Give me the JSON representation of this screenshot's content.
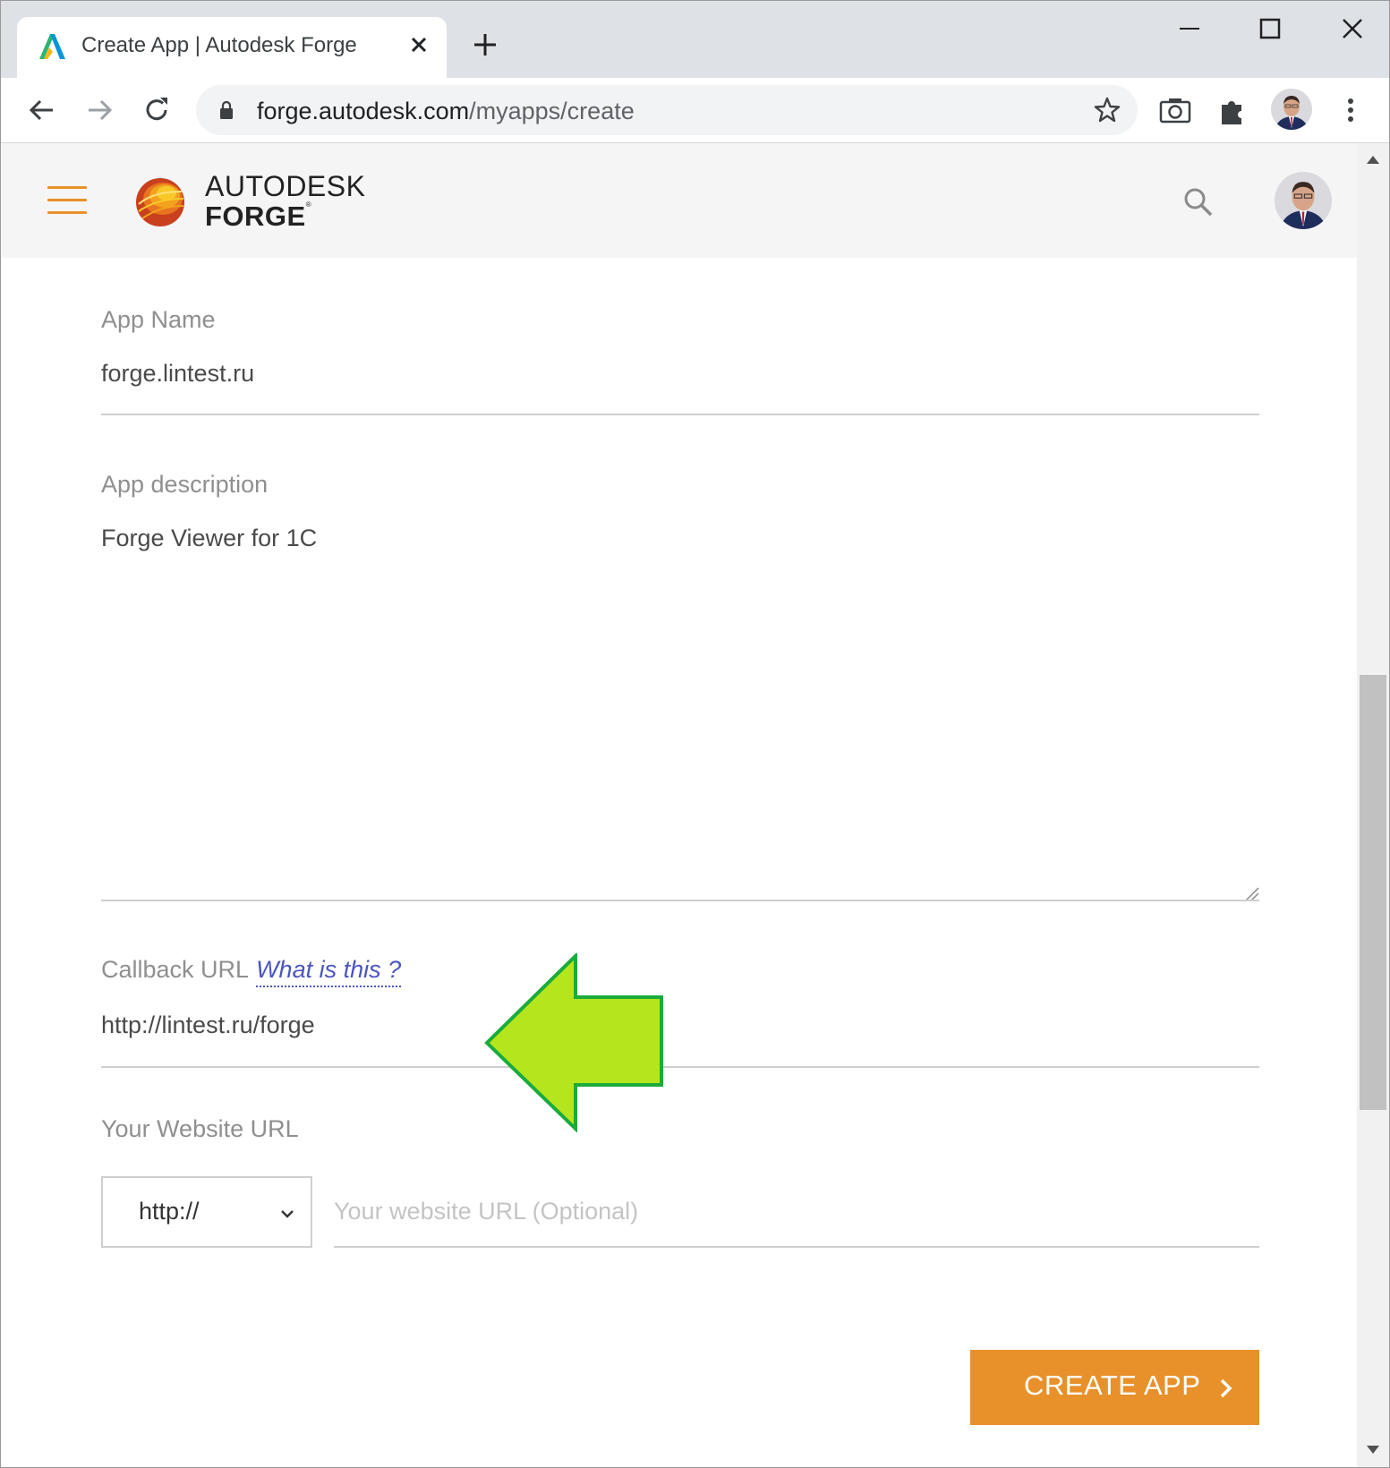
{
  "browser": {
    "tab_title": "Create App | Autodesk Forge",
    "url_host": "forge.autodesk.com",
    "url_path": "/myapps/create"
  },
  "header": {
    "brand_top": "AUTODESK",
    "brand_bottom": "FORGE",
    "brand_mark": "®"
  },
  "form": {
    "app_name_label": "App Name",
    "app_name_value": "forge.lintest.ru",
    "description_label": "App description",
    "description_value": "Forge Viewer for 1C",
    "callback_label": "Callback URL",
    "callback_help_link": "What is this ?",
    "callback_value": "http://lintest.ru/forge",
    "website_label": "Your Website URL",
    "protocol_selected": "http://",
    "website_placeholder": "Your website URL (Optional)",
    "submit_label": "CREATE APP"
  },
  "colors": {
    "accent": "#e8912b",
    "link": "#4b55c0",
    "callout_arrow_fill": "#b5e61d",
    "callout_arrow_stroke": "#1aab3c"
  },
  "icons": [
    "autodesk-favicon-icon",
    "close-icon",
    "plus-icon",
    "minimize-icon",
    "maximize-icon",
    "back-arrow-icon",
    "forward-arrow-icon",
    "reload-icon",
    "lock-icon",
    "star-icon",
    "camera-icon",
    "puzzle-icon",
    "more-vert-icon",
    "hamburger-icon",
    "forge-logo-icon",
    "search-icon",
    "chevron-down-icon",
    "chevron-right-icon",
    "resize-grip-icon",
    "left-arrow-callout-icon"
  ]
}
